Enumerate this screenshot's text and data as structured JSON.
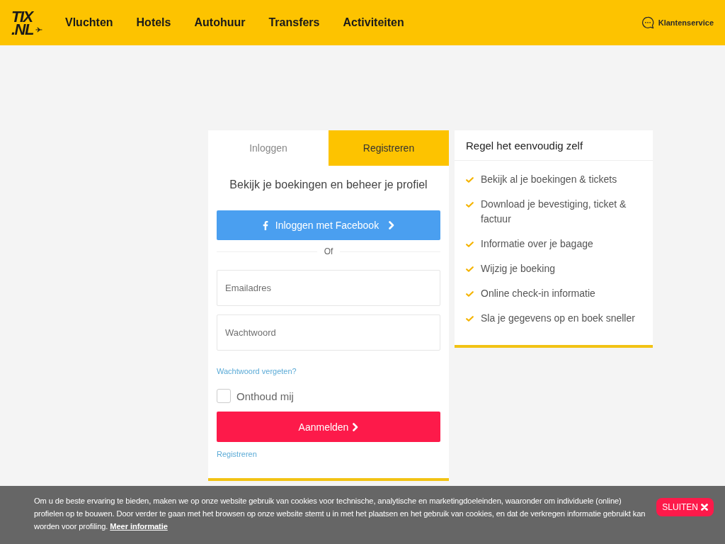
{
  "header": {
    "logo": [
      "TIX",
      ".NL"
    ],
    "nav": [
      {
        "label": "Vluchten"
      },
      {
        "label": "Hotels"
      },
      {
        "label": "Autohuur"
      },
      {
        "label": "Transfers"
      },
      {
        "label": "Activiteiten"
      }
    ],
    "customer_service": "Klantenservice"
  },
  "login_card": {
    "tabs": [
      {
        "label": "Inloggen",
        "selected": true
      },
      {
        "label": "Registreren",
        "selected": false
      }
    ],
    "heading": "Bekijk je boekingen en beheer je profiel",
    "facebook_button": "Inloggen met Facebook",
    "divider": "Of",
    "fields": [
      {
        "placeholder": "Emailadres"
      },
      {
        "placeholder": "Wachtwoord"
      }
    ],
    "forgot_link": "Wachtwoord vergeten?",
    "remember": {
      "label": "Onthoud mij",
      "checked": false
    },
    "submit_button": "Aanmelden",
    "register_link": "Registreren"
  },
  "benefits_card": {
    "title": "Regel het eenvoudig zelf",
    "items": [
      "Bekijk al je boekingen & tickets",
      "Download je bevestiging, ticket & factuur",
      "Informatie over je bagage",
      "Wijzig je boeking",
      "Online check-in informatie",
      "Sla je gegevens op en boek sneller"
    ]
  },
  "cookie_bar": {
    "text": "Om u de beste ervaring te bieden, maken we op onze website gebruik van cookies voor technische, analytische en marketingdoeleinden, waaronder om individuele (online) profielen op te bouwen. Door verder te gaan met het browsen op onze website stemt u in met het plaatsen en het gebruik van cookies, en dat de verkregen informatie gebruikt kan worden voor profiling.",
    "link": "Meer informatie",
    "close_button": "SLUITEN"
  }
}
